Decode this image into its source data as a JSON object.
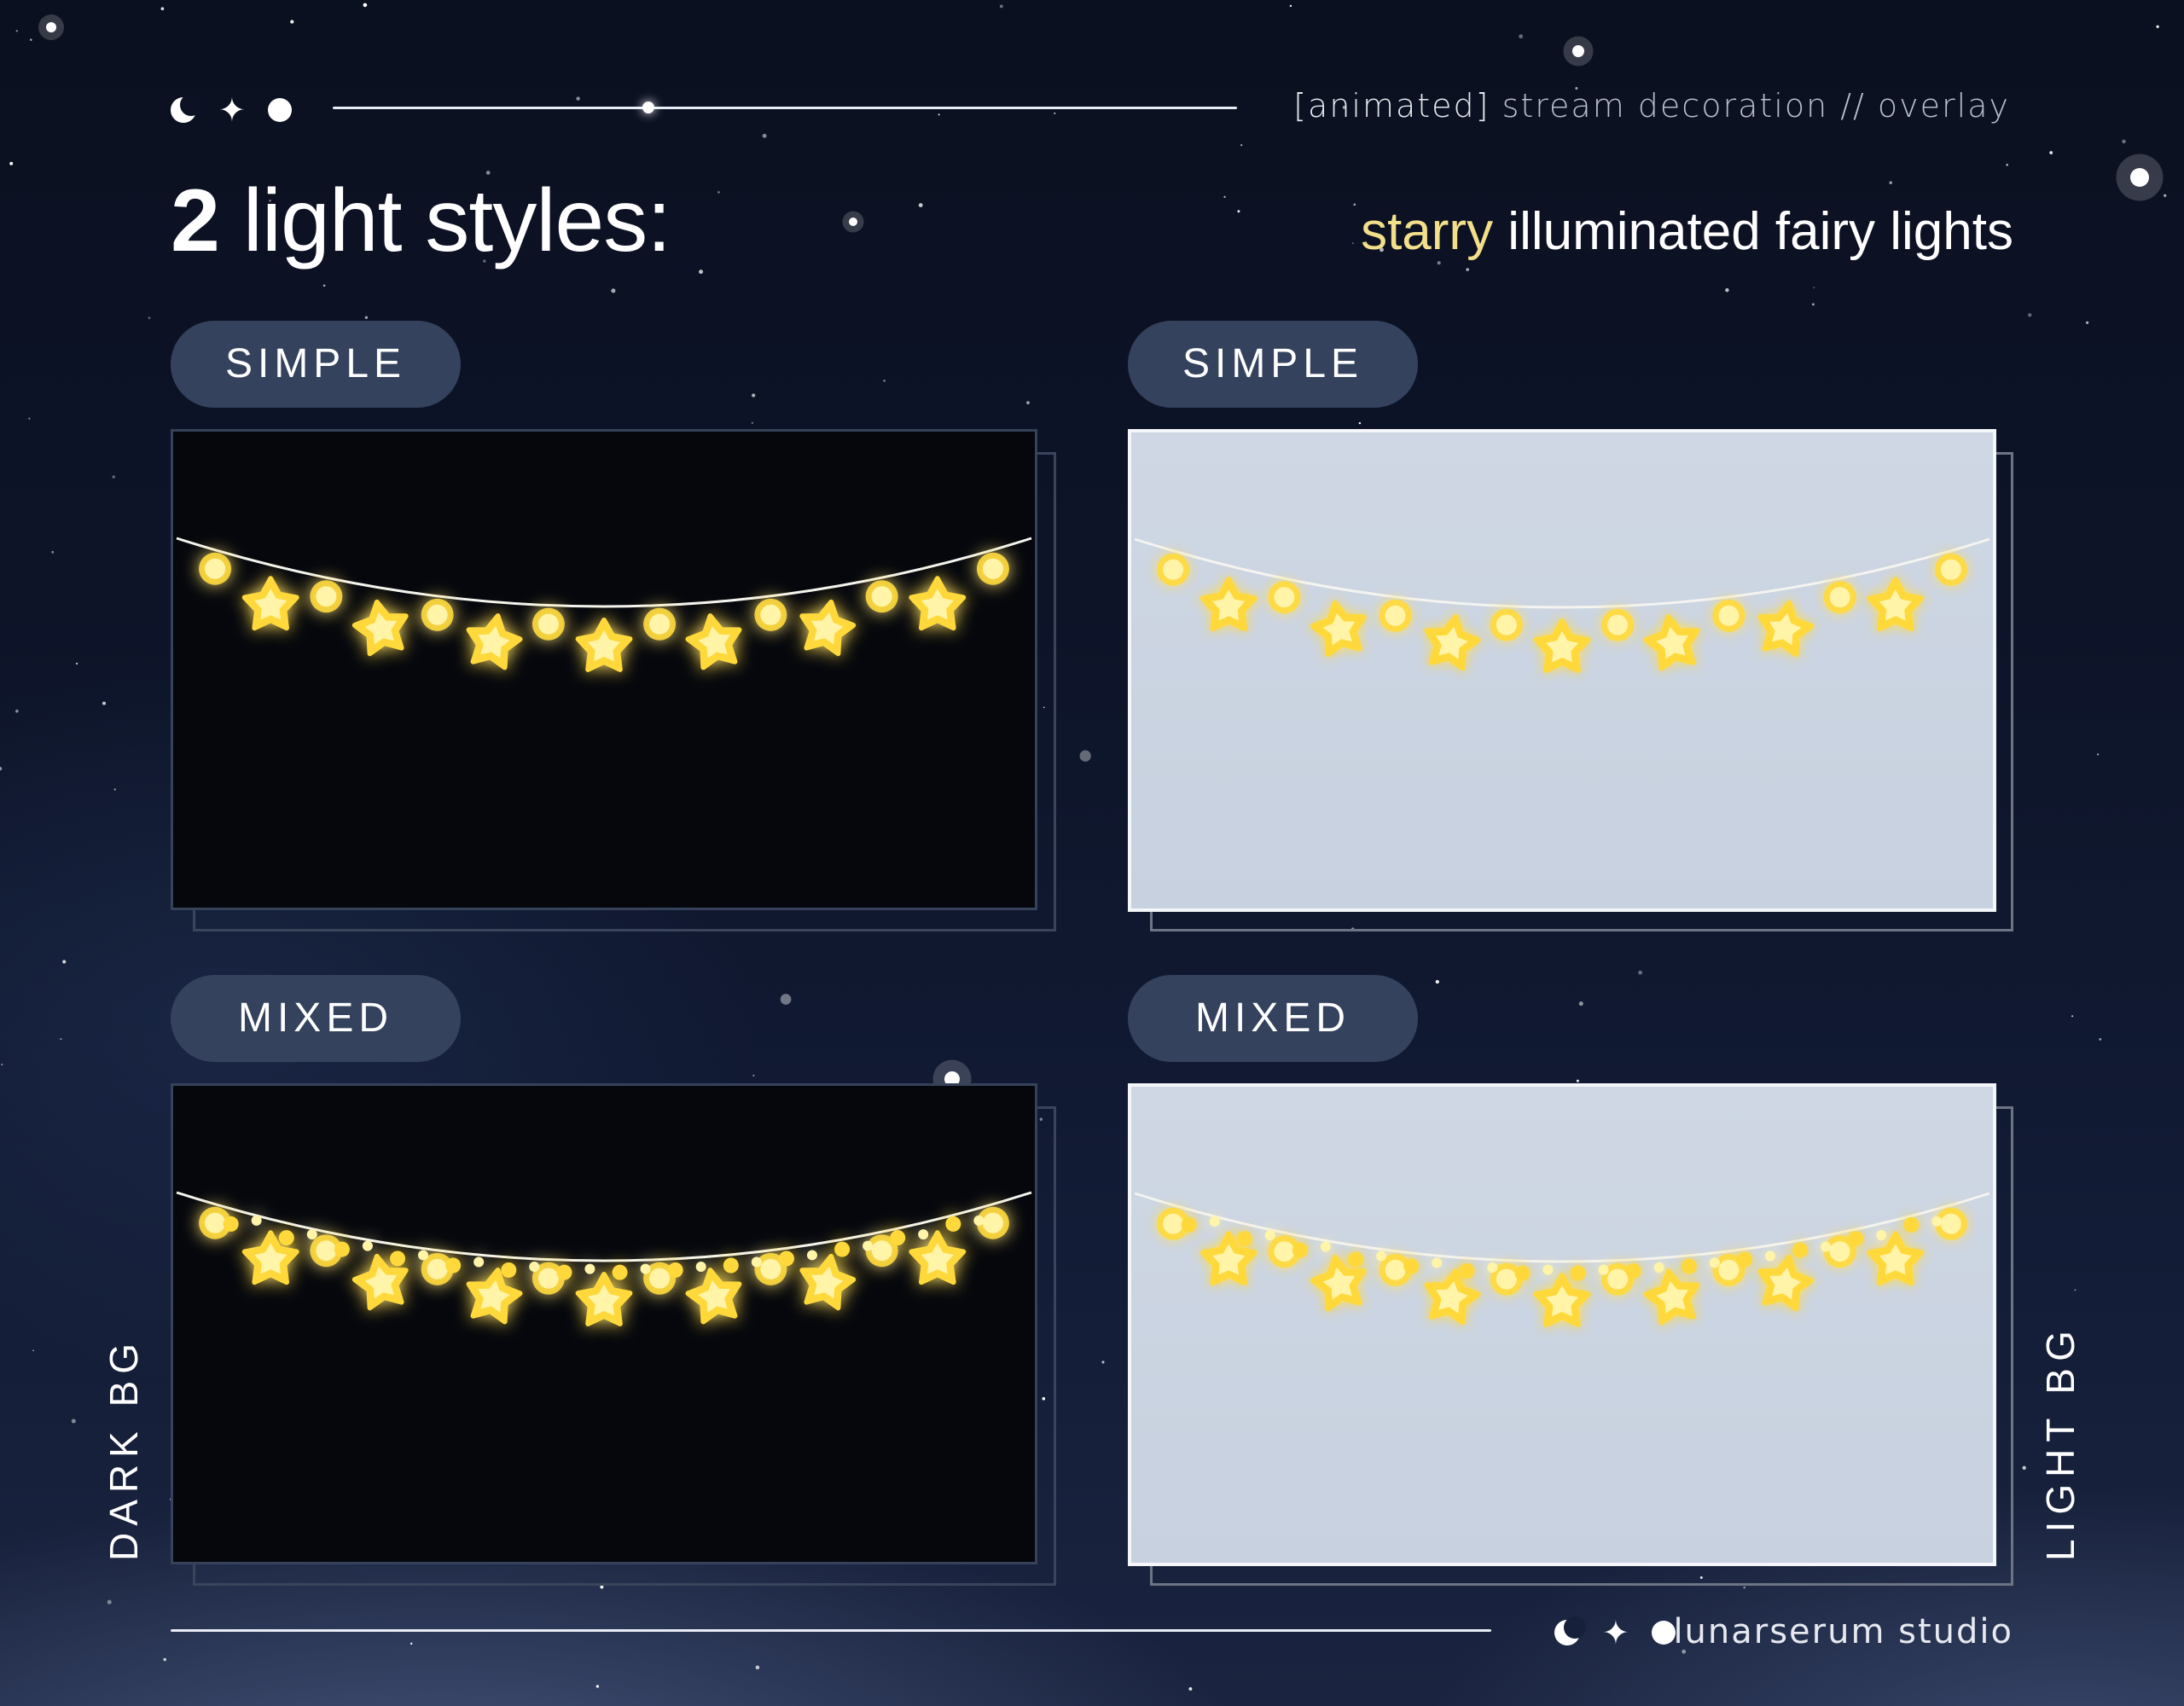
{
  "header": {
    "tagline_lead": "[animated]",
    "tagline_rest": " stream decoration // overlay",
    "title_number": "2",
    "title_rest": " light styles:",
    "subtitle_accent": "starry",
    "subtitle_rest": " illuminated fairy lights"
  },
  "columns": {
    "left_label": "DARK BG",
    "right_label": "LIGHT BG"
  },
  "panels": [
    {
      "label": "SIMPLE",
      "variant": "simple",
      "background": "dark"
    },
    {
      "label": "SIMPLE",
      "variant": "simple",
      "background": "light"
    },
    {
      "label": "MIXED",
      "variant": "mixed",
      "background": "dark"
    },
    {
      "label": "MIXED",
      "variant": "mixed",
      "background": "light"
    }
  ],
  "footer": {
    "studio": "lunarserum studio"
  },
  "icons": [
    "moon-icon",
    "sparkle-icon",
    "circle-icon"
  ],
  "colors": {
    "accent": "#f3df8a",
    "pill": "#34425e",
    "dark_panel": "#05070d",
    "light_panel": "#cbd4e2",
    "bulb": "#fff4a8",
    "bulb_glow": "#ffd93a"
  }
}
